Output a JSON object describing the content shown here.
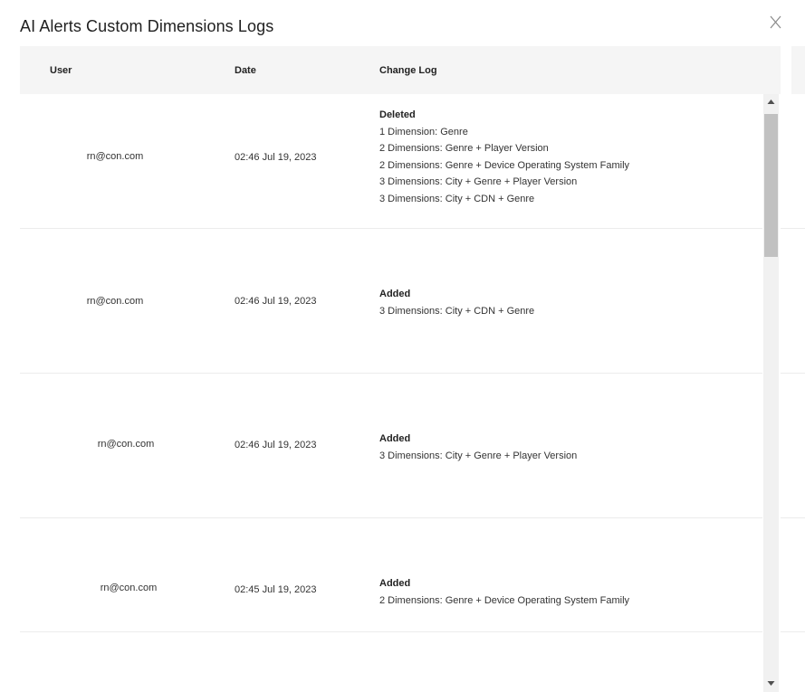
{
  "dialog": {
    "title": "AI Alerts Custom Dimensions Logs",
    "close_icon": "close-icon"
  },
  "table": {
    "headers": {
      "user": "User",
      "date": "Date",
      "change_log": "Change Log"
    },
    "rows": [
      {
        "user": "rn@con.com",
        "date": "02:46 Jul 19, 2023",
        "action": "Deleted",
        "lines": [
          "1 Dimension: Genre",
          "2 Dimensions: Genre + Player Version",
          "2 Dimensions: Genre + Device Operating System Family",
          "3 Dimensions: City + Genre + Player Version",
          "3 Dimensions: City + CDN + Genre"
        ]
      },
      {
        "user": "rn@con.com",
        "date": "02:46 Jul 19, 2023",
        "action": "Added",
        "lines": [
          "3 Dimensions: City + CDN + Genre"
        ]
      },
      {
        "user": "rn@con.com",
        "date": "02:46 Jul 19, 2023",
        "action": "Added",
        "lines": [
          "3 Dimensions: City + Genre + Player Version"
        ]
      },
      {
        "user": "rn@con.com",
        "date": "02:45 Jul 19, 2023",
        "action": "Added",
        "lines": [
          "2 Dimensions: Genre + Device Operating System Family"
        ]
      }
    ]
  },
  "scrollbar": {
    "up_icon": "scroll-up-arrow-icon",
    "down_icon": "scroll-down-arrow-icon"
  },
  "colors": {
    "header_bg": "#f5f5f5",
    "row_border": "#ececec",
    "scroll_track": "#f1f1f1",
    "scroll_thumb": "#c1c1c1"
  }
}
